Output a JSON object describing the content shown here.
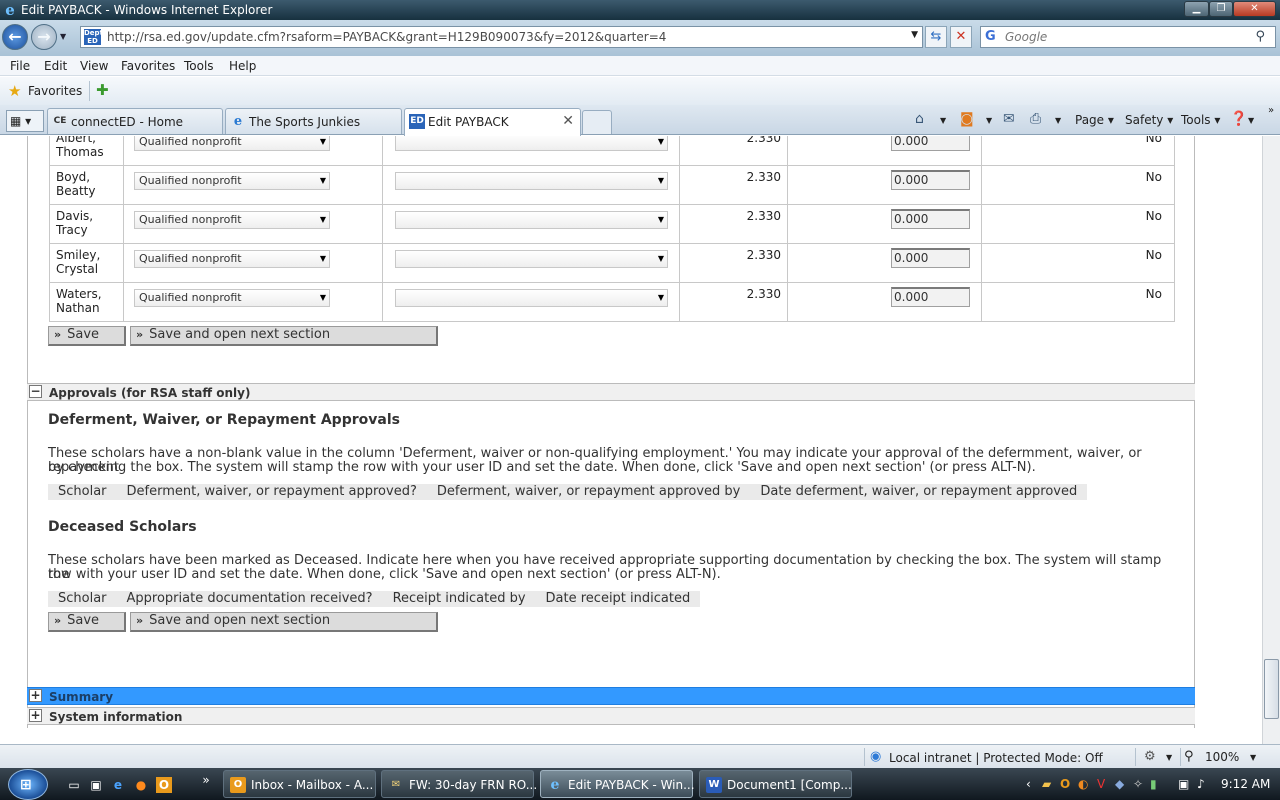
{
  "window": {
    "title": "Edit PAYBACK - Windows Internet Explorer"
  },
  "address": {
    "url": "http://rsa.ed.gov/update.cfm?rsaform=PAYBACK&grant=H129B090073&fy=2012&quarter=4"
  },
  "search": {
    "placeholder": "Google"
  },
  "menu": [
    "File",
    "Edit",
    "View",
    "Favorites",
    "Tools",
    "Help"
  ],
  "favorites": {
    "label": "Favorites"
  },
  "tabs": [
    {
      "label": "connectED - Home",
      "icon": "CE"
    },
    {
      "label": "The Sports Junkies",
      "icon": "e"
    },
    {
      "label": "Edit PAYBACK",
      "icon": "ED"
    }
  ],
  "commandbar": {
    "page": "Page",
    "safety": "Safety",
    "tools": "Tools"
  },
  "scholars": [
    {
      "first": "Albert,",
      "last": "Thomas",
      "type": "Qualified nonprofit",
      "rate": "2.330",
      "amount": "0.000",
      "flag": "No"
    },
    {
      "first": "Boyd,",
      "last": "Beatty",
      "type": "Qualified nonprofit",
      "rate": "2.330",
      "amount": "0.000",
      "flag": "No"
    },
    {
      "first": "Davis,",
      "last": "Tracy",
      "type": "Qualified nonprofit",
      "rate": "2.330",
      "amount": "0.000",
      "flag": "No"
    },
    {
      "first": "Smiley,",
      "last": "Crystal",
      "type": "Qualified nonprofit",
      "rate": "2.330",
      "amount": "0.000",
      "flag": "No"
    },
    {
      "first": "Waters,",
      "last": "Nathan",
      "type": "Qualified nonprofit",
      "rate": "2.330",
      "amount": "0.000",
      "flag": "No"
    }
  ],
  "buttons": {
    "save": "Save",
    "save_next": "Save and open next section"
  },
  "approvals": {
    "header": "Approvals (for RSA staff only)",
    "deferment_title": "Deferment, Waiver, or Repayment Approvals",
    "deferment_text_1": "These scholars have a non-blank value in the column 'Deferment, waiver or non-qualifying employment.' You may indicate your approval of the defermment, waiver, or repayment",
    "deferment_text_2": "by checking the box. The system will stamp the row with your user ID and set the date. When done, click 'Save and open next section' (or press ALT-N).",
    "deferment_cols": [
      "Scholar",
      "Deferment, waiver, or repayment approved?",
      "Deferment, waiver, or repayment approved by",
      "Date deferment, waiver, or repayment approved"
    ],
    "deceased_title": "Deceased Scholars",
    "deceased_text_1": "These scholars have been marked as Deceased. Indicate here when you have received appropriate supporting documentation by checking the box. The system will stamp the",
    "deceased_text_2": "row with your user ID and set the date. When done, click 'Save and open next section' (or press ALT-N).",
    "deceased_cols": [
      "Scholar",
      "Appropriate documentation received?",
      "Receipt indicated by",
      "Date receipt indicated"
    ]
  },
  "sections": {
    "summary": "Summary",
    "system": "System information"
  },
  "status": {
    "zone": "Local intranet | Protected Mode: Off",
    "zoom": "100%"
  },
  "taskbar": {
    "items": [
      {
        "label": "Inbox - Mailbox - A...",
        "icon": "O"
      },
      {
        "label": "FW: 30-day FRN RO...",
        "icon": "✉"
      },
      {
        "label": "Edit PAYBACK - Win...",
        "icon": "e"
      },
      {
        "label": "Document1 [Comp...",
        "icon": "W"
      }
    ],
    "clock": "9:12 AM"
  }
}
